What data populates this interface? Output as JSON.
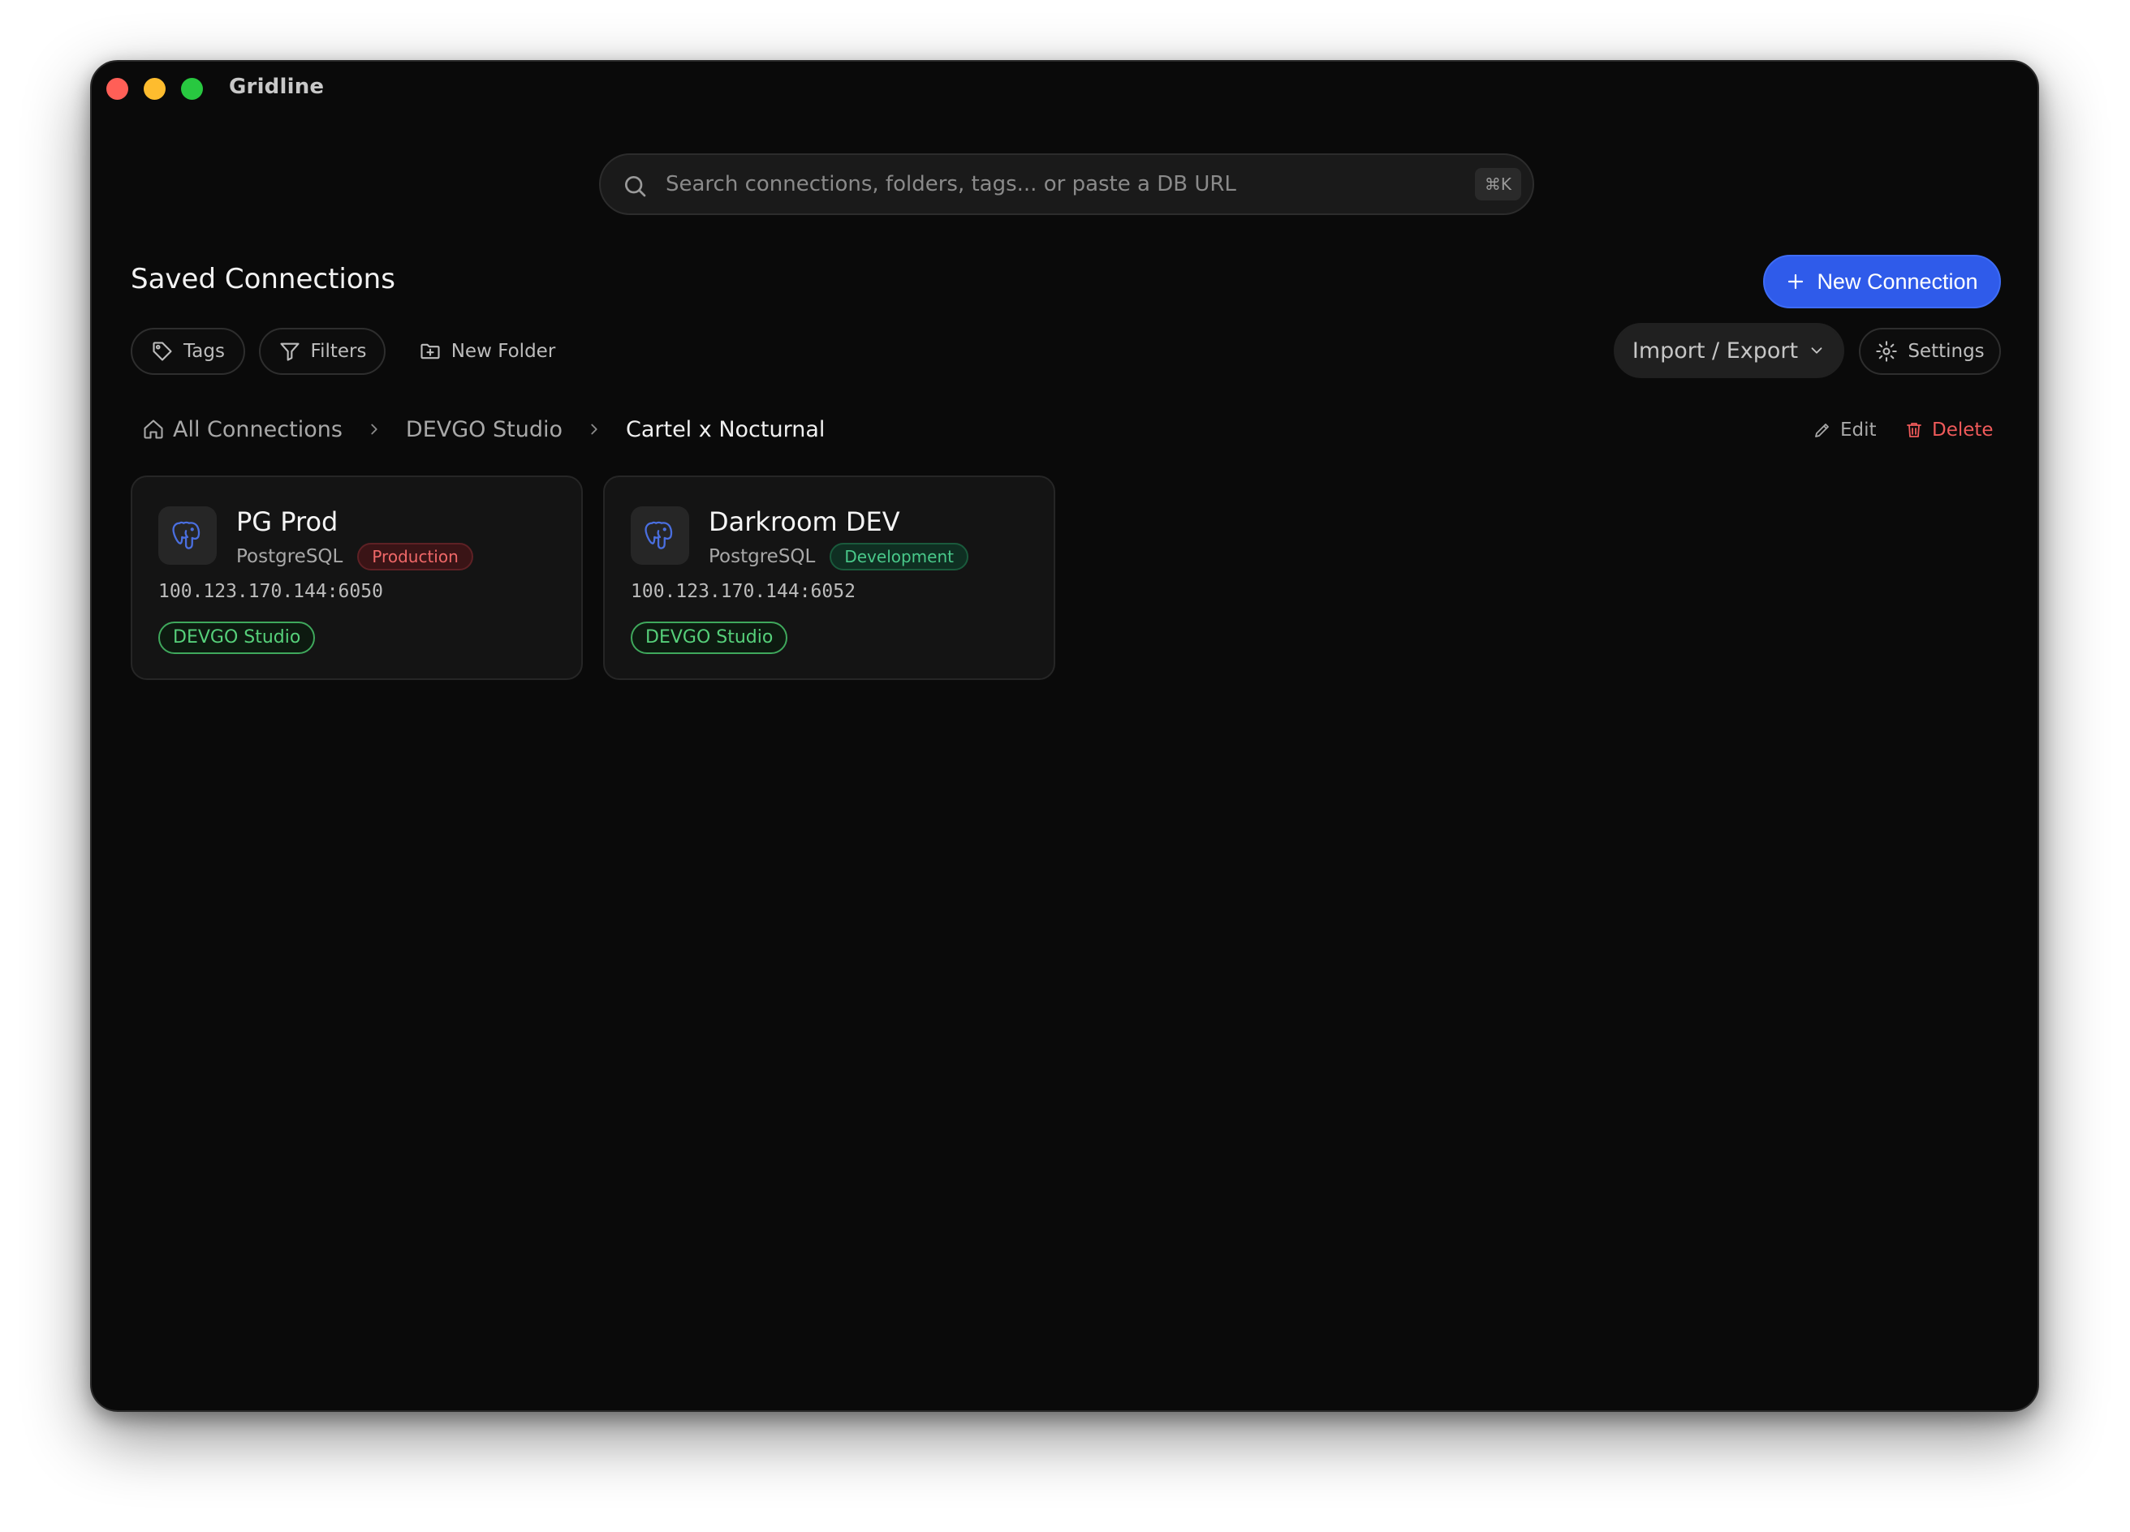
{
  "window": {
    "title": "Gridline"
  },
  "search": {
    "placeholder": "Search connections, folders, tags... or paste a DB URL",
    "shortcut": "⌘K"
  },
  "header": {
    "title": "Saved Connections",
    "new_connection_label": "New Connection"
  },
  "toolbar": {
    "tags_label": "Tags",
    "filters_label": "Filters",
    "new_folder_label": "New Folder",
    "import_export_label": "Import / Export",
    "settings_label": "Settings"
  },
  "breadcrumb": {
    "items": [
      "All Connections",
      "DEVGO Studio",
      "Cartel x Nocturnal"
    ]
  },
  "folder_actions": {
    "edit_label": "Edit",
    "delete_label": "Delete"
  },
  "connections": [
    {
      "name": "PG Prod",
      "engine": "PostgreSQL",
      "environment": "Production",
      "address": "100.123.170.144:6050",
      "folder": "DEVGO Studio"
    },
    {
      "name": "Darkroom DEV",
      "engine": "PostgreSQL",
      "environment": "Development",
      "address": "100.123.170.144:6052",
      "folder": "DEVGO Studio"
    }
  ],
  "colors": {
    "background": "#0a0a0a",
    "accent": "#2f5bea",
    "danger": "#ef5a5a",
    "production": "#f06868",
    "development": "#49c98a",
    "folder_tag": "#56d07a"
  },
  "icons": {
    "search": "search-icon",
    "plus": "plus-icon",
    "tag": "tag-icon",
    "filter": "filter-icon",
    "folder_plus": "folder-plus-icon",
    "chevron_down": "chevron-down-icon",
    "gear": "gear-icon",
    "home": "home-icon",
    "chevron_right": "chevron-right-icon",
    "pencil": "pencil-icon",
    "trash": "trash-icon",
    "database": "postgresql-elephant-icon"
  }
}
